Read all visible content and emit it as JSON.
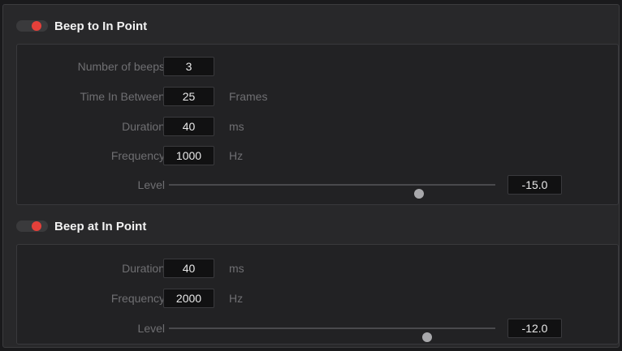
{
  "colors": {
    "toggle_on": "#e5403a",
    "panel_bg": "#222224",
    "frame_bg": "#28282a"
  },
  "section1": {
    "title": "Beep to In Point",
    "toggle_on": true,
    "rows": {
      "beeps": {
        "label": "Number of beeps",
        "value": "3"
      },
      "time_between": {
        "label": "Time In Between",
        "value": "25",
        "unit": "Frames"
      },
      "duration": {
        "label": "Duration",
        "value": "40",
        "unit": "ms"
      },
      "frequency": {
        "label": "Frequency",
        "value": "1000",
        "unit": "Hz"
      },
      "level": {
        "label": "Level",
        "value": "-15.0",
        "slider_fraction": 0.765
      }
    }
  },
  "section2": {
    "title": "Beep at In Point",
    "toggle_on": true,
    "rows": {
      "duration": {
        "label": "Duration",
        "value": "40",
        "unit": "ms"
      },
      "frequency": {
        "label": "Frequency",
        "value": "2000",
        "unit": "Hz"
      },
      "level": {
        "label": "Level",
        "value": "-12.0",
        "slider_fraction": 0.792
      }
    }
  }
}
